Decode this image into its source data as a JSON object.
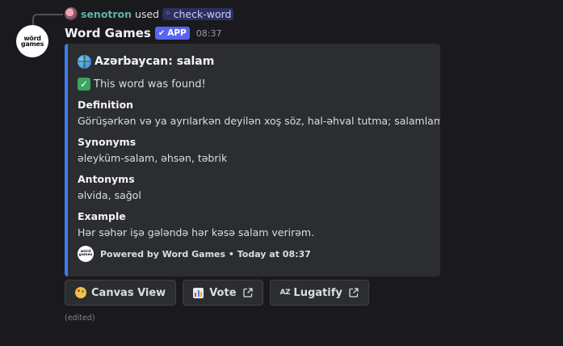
{
  "reply": {
    "username": "senotron",
    "used_text": "used",
    "command": "check-word"
  },
  "message": {
    "author": "Word Games",
    "badge": "APP",
    "timestamp": "08:37",
    "avatar_text": "wörd games",
    "edited": "(edited)"
  },
  "embed": {
    "accent_color": "#3e7df0",
    "title": "Azərbaycan: salam",
    "found_text": "This word was found!",
    "fields": [
      {
        "name": "Definition",
        "value": "Görüşərkən və ya ayrılarkən deyilən xoş söz, hal-əhval tutma; salamlama."
      },
      {
        "name": "Synonyms",
        "value": "əleyküm-salam, əhsən, təbrik"
      },
      {
        "name": "Antonyms",
        "value": "əlvida, sağol"
      },
      {
        "name": "Example",
        "value": "Hər səhər işə gələndə hər kəsə salam verirəm."
      }
    ],
    "footer": "Powered by Word Games • Today at 08:37"
  },
  "buttons": [
    {
      "label": "Canvas View",
      "icon": "palette-icon",
      "external": false
    },
    {
      "label": "Vote",
      "icon": "bar-chart-icon",
      "external": true
    },
    {
      "label": "Lugatify",
      "icon": "az-icon",
      "icon_text": "AZ",
      "external": true
    }
  ]
}
